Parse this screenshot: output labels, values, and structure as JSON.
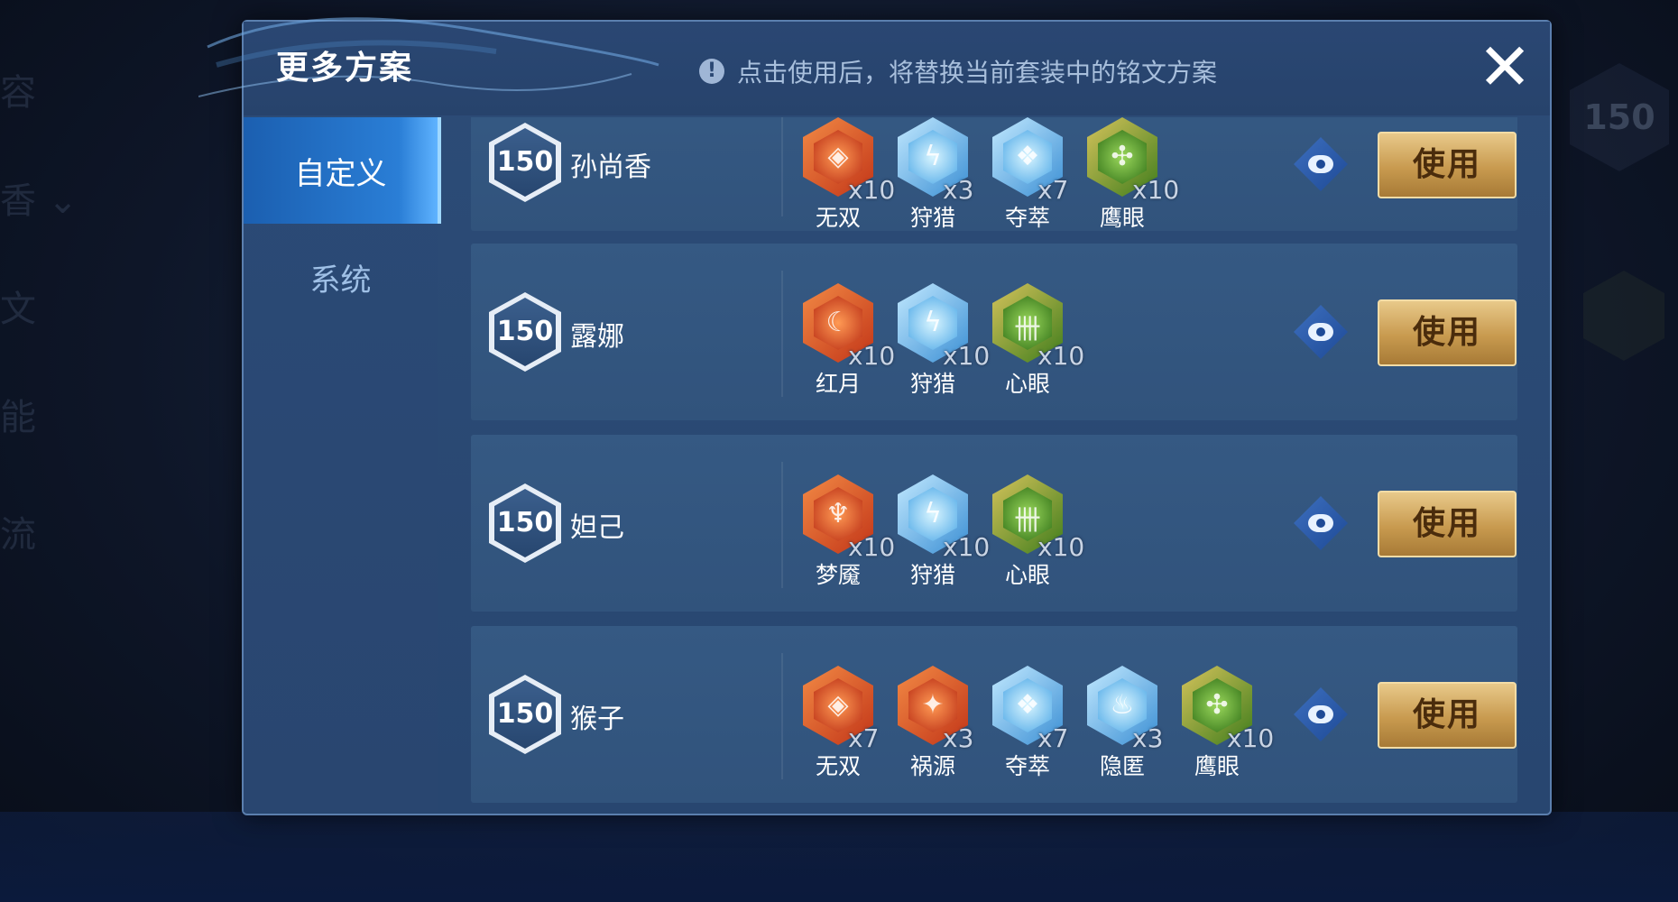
{
  "dialog": {
    "title": "更多方案",
    "notice": "点击使用后，将替换当前套装中的铭文方案",
    "close_label": "✕"
  },
  "tabs": [
    {
      "label": "自定义",
      "active": true
    },
    {
      "label": "系统",
      "active": false
    }
  ],
  "rows": [
    {
      "level": "150",
      "hero": "孙尚香",
      "runes": [
        {
          "name": "无双",
          "count": "x10",
          "color": "red",
          "glyph": "◈"
        },
        {
          "name": "狩猎",
          "count": "x3",
          "color": "blue",
          "glyph": "ϟ"
        },
        {
          "name": "夺萃",
          "count": "x7",
          "color": "blue",
          "glyph": "❖"
        },
        {
          "name": "鹰眼",
          "count": "x10",
          "color": "green",
          "glyph": "✣"
        }
      ],
      "use_label": "使用"
    },
    {
      "level": "150",
      "hero": "露娜",
      "runes": [
        {
          "name": "红月",
          "count": "x10",
          "color": "red",
          "glyph": "☾"
        },
        {
          "name": "狩猎",
          "count": "x10",
          "color": "blue",
          "glyph": "ϟ"
        },
        {
          "name": "心眼",
          "count": "x10",
          "color": "green",
          "glyph": "卌"
        }
      ],
      "use_label": "使用"
    },
    {
      "level": "150",
      "hero": "妲己",
      "runes": [
        {
          "name": "梦魇",
          "count": "x10",
          "color": "red",
          "glyph": "♆"
        },
        {
          "name": "狩猎",
          "count": "x10",
          "color": "blue",
          "glyph": "ϟ"
        },
        {
          "name": "心眼",
          "count": "x10",
          "color": "green",
          "glyph": "卌"
        }
      ],
      "use_label": "使用"
    },
    {
      "level": "150",
      "hero": "猴子",
      "runes": [
        {
          "name": "无双",
          "count": "x7",
          "color": "red",
          "glyph": "◈"
        },
        {
          "name": "祸源",
          "count": "x3",
          "color": "red",
          "glyph": "✦"
        },
        {
          "name": "夺萃",
          "count": "x7",
          "color": "blue",
          "glyph": "❖"
        },
        {
          "name": "隐匿",
          "count": "x3",
          "color": "blue",
          "glyph": "♨"
        },
        {
          "name": "鹰眼",
          "count": "x10",
          "color": "green",
          "glyph": "✣"
        }
      ],
      "use_label": "使用"
    }
  ],
  "background": {
    "hex_level": "150"
  }
}
